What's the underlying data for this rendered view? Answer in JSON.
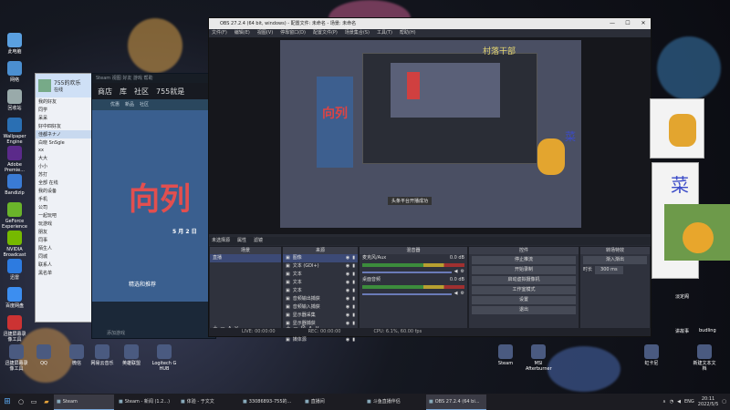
{
  "desktop_icons": [
    {
      "name": "computer-icon",
      "label": "此电脑",
      "color": "#5aa0e0"
    },
    {
      "name": "network-icon",
      "label": "网络",
      "color": "#4b8fd0"
    },
    {
      "name": "recycle-icon",
      "label": "回收站",
      "color": "#9aa"
    },
    {
      "name": "wallpaper-icon",
      "label": "Wallpaper Engine",
      "color": "#2a6fb3"
    },
    {
      "name": "premiere-icon",
      "label": "Adobe Premie...",
      "color": "#5b2a8a"
    },
    {
      "name": "bandizip-icon",
      "label": "Bandizip",
      "color": "#3a7bd5"
    },
    {
      "name": "geforce-icon",
      "label": "GeForce Experience",
      "color": "#6ab42a"
    },
    {
      "name": "nvidia-broadcast-icon",
      "label": "NVIDIA Broadcast",
      "color": "#76b900"
    },
    {
      "name": "xunlei-icon",
      "label": "迅雷",
      "color": "#2d7be0"
    },
    {
      "name": "baidu-icon",
      "label": "百度网盘",
      "color": "#3c8ef0"
    },
    {
      "name": "bandicam-icon",
      "label": "迅捷屏幕录像工具",
      "color": "#c33"
    }
  ],
  "chat": {
    "title": "755的欢乐",
    "status": "在线",
    "items": [
      "我的好友",
      "同学",
      "呆呆",
      "好中四好友",
      "佳都ネナノ",
      "白晓 SnSgle",
      "xx",
      "大大",
      "小小",
      "苏打",
      "全部 在线",
      "我的设备",
      "手机",
      "公司",
      "一起玩吧",
      "玩游戏",
      "朋友",
      "同事",
      "陌生人",
      "同城",
      "联系人",
      "黑名单"
    ],
    "selected_index": 4
  },
  "steam": {
    "titlebar": "Steam  视图  好友  游戏  帮助",
    "nav": [
      "商店",
      "库",
      "社区",
      "755就是"
    ],
    "tabs": [
      "优惠",
      "新品",
      "社区"
    ],
    "big_text": "向列",
    "sub_text": "5 月 2 日",
    "section": "精选和推荐",
    "footer": "添加游戏"
  },
  "obs": {
    "title": "OBS 27.2.4 (64 bit, windows) - 配置文件: 未命名 - 场景: 未命名",
    "menu": [
      "文件(F)",
      "编辑(E)",
      "视图(V)",
      "停靠窗口(D)",
      "配置文件(P)",
      "场景集合(S)",
      "工具(T)",
      "帮助(H)"
    ],
    "overlay_text": "村落干部",
    "overlay_text2": "菜",
    "preview_caption": "头条平台开播成功",
    "source_bar": "未选择源",
    "tabs": [
      "属性",
      "滤镜"
    ],
    "scenes_title": "场景",
    "scenes": [
      "直播"
    ],
    "sources_title": "来源",
    "sources": [
      "图像",
      "文本 (GDI+)",
      "文本",
      "文本",
      "文本",
      "音频输出捕获",
      "音频输入捕获",
      "显示器采集",
      "显示器捕获",
      "颜色源",
      "媒体源"
    ],
    "mixer_title": "混音器",
    "mixer": [
      {
        "label": "麦克风/Aux",
        "db": "0.0 dB"
      },
      {
        "label": "桌面音频",
        "db": "0.0 dB"
      }
    ],
    "transitions_title": "转场特效",
    "transition_type": "渐入渐出",
    "duration_label": "时长",
    "duration": "300 ms",
    "controls_title": "控件",
    "controls": [
      "停止推流",
      "开始录制",
      "启动虚拟摄像机",
      "工作室模式",
      "设置",
      "退出"
    ],
    "status_items": [
      "LIVE: 00:00:00",
      "REC: 00:00:00",
      "CPU: 6.1%, 60.00 fps"
    ]
  },
  "right_windows": {
    "caption": "菜",
    "label1": "淡定阁",
    "label2": "讲故事",
    "label3": "budling"
  },
  "bottom_icons": [
    {
      "name": "bandicam2-icon",
      "label": "迅捷屏幕录像工具"
    },
    {
      "name": "qq-icon",
      "label": "QQ"
    },
    {
      "name": "wechat-icon",
      "label": "微信"
    },
    {
      "name": "ps-icon",
      "label": "网易云音乐"
    },
    {
      "name": "lol-icon",
      "label": "英雄联盟"
    },
    {
      "name": "logitech-icon",
      "label": "Logitech G HUB"
    },
    {
      "name": "steam-app-icon",
      "label": "Steam"
    },
    {
      "name": "nvidia2-icon",
      "label": "MSI Afterburner"
    },
    {
      "name": "folder-icon",
      "label": "虹卡尼"
    },
    {
      "name": "new-text-icon",
      "label": "新建文本文档"
    }
  ],
  "taskbar": {
    "tasks": [
      {
        "label": "Steam",
        "active": true
      },
      {
        "label": "Steam - 新闻 (1.2...)",
        "active": false
      },
      {
        "label": "体验 - 于文文",
        "active": false
      },
      {
        "label": "33086893-755的...",
        "active": false
      },
      {
        "label": "直播间",
        "active": false
      },
      {
        "label": "斗鱼直播伴侣",
        "active": false
      },
      {
        "label": "OBS 27.2.4 (64 bi...",
        "active": true
      }
    ],
    "lang": "ENG",
    "time": "20:11",
    "date": "2022/5/5"
  }
}
